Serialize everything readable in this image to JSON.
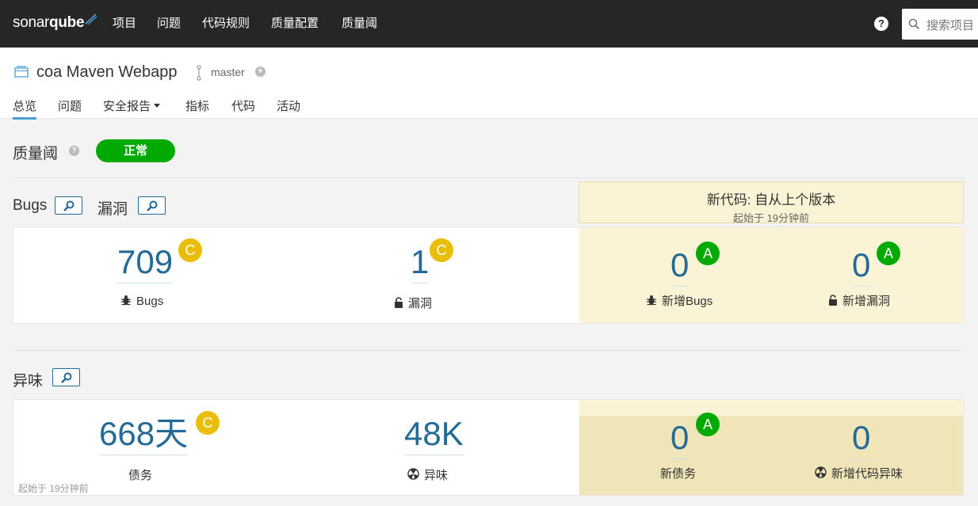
{
  "app": {
    "logo_light": "sonar",
    "logo_bold": "qube"
  },
  "topnav": {
    "items": [
      "项目",
      "问题",
      "代码规则",
      "质量配置",
      "质量阈"
    ],
    "help": "?",
    "search_placeholder": "搜索项目"
  },
  "project": {
    "name": "coa Maven Webapp",
    "branch": "master",
    "tabs": [
      "总览",
      "问题",
      "安全报告",
      "指标",
      "代码",
      "活动"
    ]
  },
  "quality_gate": {
    "title": "质量阈",
    "status": "正常"
  },
  "sections": {
    "bugs_title": "Bugs",
    "vuln_title": "漏洞",
    "smells_title": "异味"
  },
  "new_code": {
    "title": "新代码: 自从上个版本",
    "since": "起始于 19分钟前"
  },
  "metrics": {
    "bugs": {
      "value": "709",
      "rating": "C",
      "label": "Bugs"
    },
    "vulnerabilities": {
      "value": "1",
      "rating": "C",
      "label": "漏洞"
    },
    "new_bugs": {
      "value": "0",
      "rating": "A",
      "label": "新增Bugs"
    },
    "new_vulnerabilities": {
      "value": "0",
      "rating": "A",
      "label": "新增漏洞"
    },
    "debt": {
      "value": "668天",
      "rating": "C",
      "label": "债务"
    },
    "code_smells": {
      "value": "48K",
      "label": "异味"
    },
    "new_debt": {
      "value": "0",
      "rating": "A",
      "label": "新债务"
    },
    "new_code_smells": {
      "value": "0",
      "label": "新增代码异味"
    }
  },
  "smells_since": "起始于 19分钟前",
  "colors": {
    "topbar": "#262626",
    "accent": "#236a97",
    "rating_c": "#eabe06",
    "rating_a": "#00aa00",
    "gate_ok": "#00aa00",
    "new_code_bg": "#fbf3d5"
  }
}
